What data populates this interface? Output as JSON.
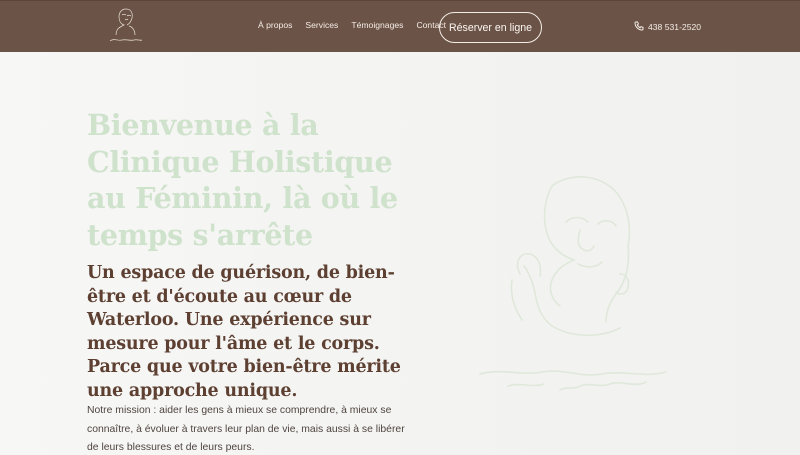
{
  "nav": {
    "links": [
      "À propos",
      "Services",
      "Témoignages",
      "Contact"
    ],
    "cta_label": "Réserver en ligne",
    "phone": "438 531-2520",
    "logo_icon": "woman-face-line-art-logo"
  },
  "hero": {
    "title": "Bienvenue à la Clinique Holistique au Féminin, là où le temps s'arrête",
    "subtitle": "Un espace de guérison, de bien-être et d'écoute au cœur de Waterloo. Une expérience sur mesure pour l'âme et le corps. Parce que votre bien-être mérite une approche unique.",
    "mission": "Notre mission : aider les gens à mieux se comprendre, à mieux se connaître, à évoluer à travers leur plan de vie, mais aussi à se libérer de leurs blessures et de leurs peurs.",
    "illustration_icon": "woman-face-line-art"
  },
  "colors": {
    "header_bg": "#6b5347",
    "title_green": "#cfe2cc",
    "subtitle_brown": "#5d4032",
    "page_bg": "#f3f3f1"
  }
}
